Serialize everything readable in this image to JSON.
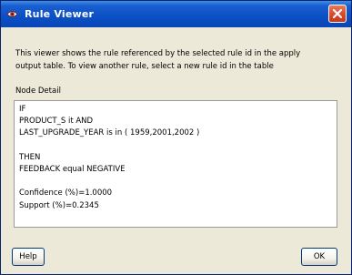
{
  "window": {
    "title": "Rule Viewer",
    "icon": "rule-viewer-app-icon",
    "close_icon": "close-icon"
  },
  "description": {
    "line1": "This viewer shows the rule referenced by the selected rule id in the apply",
    "line2": "output table. To view another rule, select a new rule id in the table"
  },
  "node_detail": {
    "label": "Node Detail",
    "lines": [
      "IF",
      "PRODUCT_S it AND",
      "LAST_UPGRADE_YEAR is in ( 1959,2001,2002 )",
      "",
      "THEN",
      "FEEDBACK equal NEGATIVE",
      "",
      "Confidence (%)=1.0000",
      "Support (%)=0.2345"
    ]
  },
  "buttons": {
    "help": "Help",
    "ok": "OK"
  },
  "colors": {
    "titlebar": "#0b4fc4",
    "window_bg": "#ece9d8",
    "close_button": "#d9482b"
  }
}
